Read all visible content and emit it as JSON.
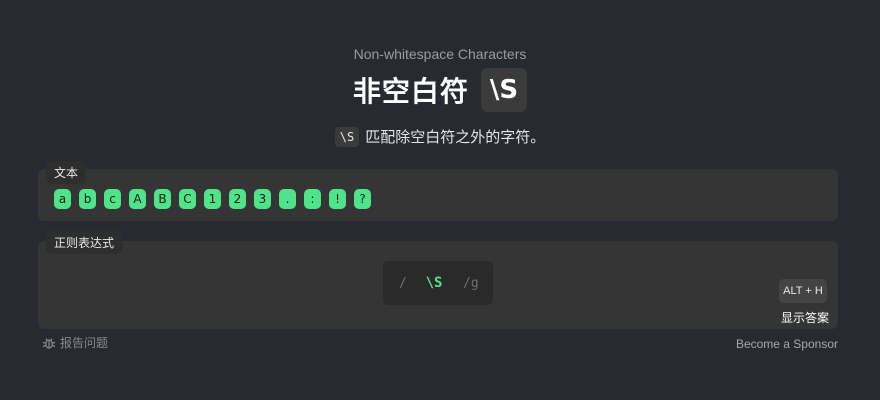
{
  "header": {
    "subtitle": "Non-whitespace Characters",
    "title": "非空白符",
    "title_code": "\\S"
  },
  "description": {
    "code": "\\S",
    "text": "匹配除空白符之外的字符。"
  },
  "text_panel": {
    "label": "文本",
    "chips": [
      "a",
      "b",
      "c",
      "A",
      "B",
      "C",
      "1",
      "2",
      "3",
      ".",
      ":",
      "!",
      "?"
    ]
  },
  "regex_panel": {
    "label": "正则表达式",
    "open_delim": "/",
    "value": "\\S",
    "flags": "/g"
  },
  "hint": {
    "shortcut": "ALT + H",
    "label": "显示答案"
  },
  "footer": {
    "report_label": "报告问题",
    "sponsor_label": "Become a Sponsor"
  },
  "colors": {
    "background": "#272a31",
    "panel": "#353535",
    "accent_green": "#4fe38a"
  }
}
